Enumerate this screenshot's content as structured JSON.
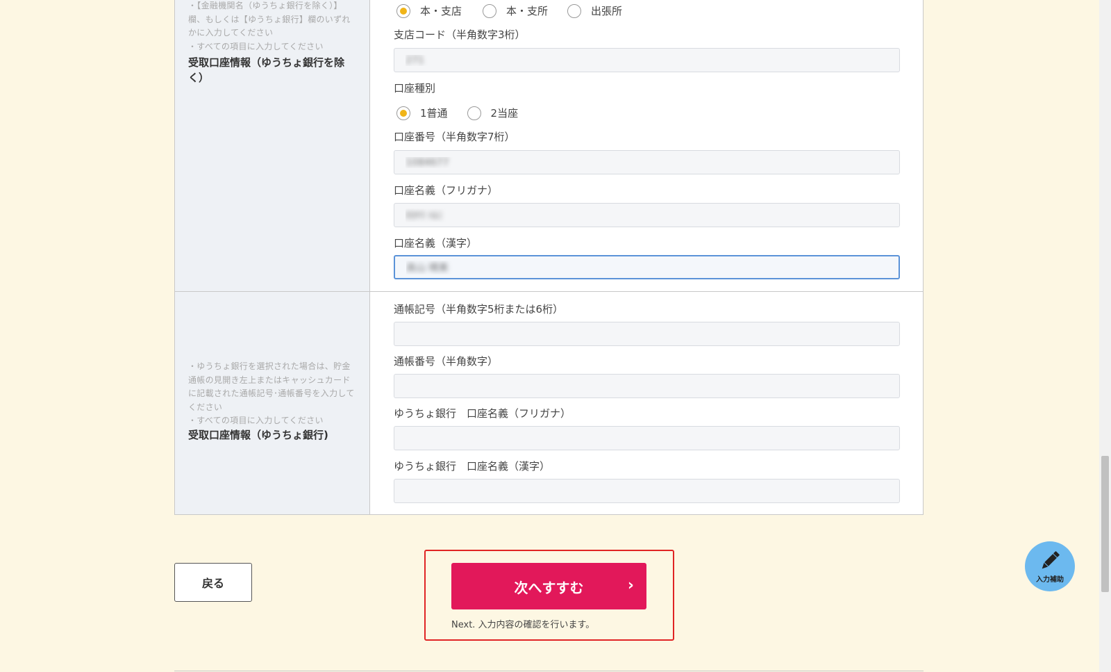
{
  "bank_section": {
    "notes": [
      "・【金融機関名（ゆうちょ銀行を除く）】欄、もしくは【ゆうちょ銀行】欄のいずれかに入力してください",
      "・すべての項目に入力してください"
    ],
    "title": "受取口座情報（ゆうちょ銀行を除く）",
    "branch_type_options": [
      {
        "label": "本・支店",
        "checked": true
      },
      {
        "label": "本・支所",
        "checked": false
      },
      {
        "label": "出張所",
        "checked": false
      }
    ],
    "branch_code": {
      "label": "支店コード（半角数字3桁）",
      "value": "271"
    },
    "account_type": {
      "label": "口座種別",
      "options": [
        {
          "label": "1普通",
          "checked": true
        },
        {
          "label": "2当座",
          "checked": false
        }
      ]
    },
    "account_number": {
      "label": "口座番号（半角数字7桁）",
      "value": "1084677"
    },
    "holder_kana": {
      "label": "口座名義（フリガナ）",
      "value": "ﾀｶﾔﾏ ﾊﾙﾐ"
    },
    "holder_kanji": {
      "label": "口座名義（漢字）",
      "value": "高山 晴美"
    }
  },
  "yucho_section": {
    "notes": [
      "・ゆうちょ銀行を選択された場合は、貯金通帳の見開き左上またはキャッシュカードに記載された通帳記号･通帳番号を入力してください",
      "・すべての項目に入力してください"
    ],
    "title": "受取口座情報（ゆうちょ銀行)",
    "passbook_symbol": {
      "label": "通帳記号（半角数字5桁または6桁）",
      "value": ""
    },
    "passbook_number": {
      "label": "通帳番号（半角数字）",
      "value": ""
    },
    "holder_kana": {
      "label": "ゆうちょ銀行　口座名義（フリガナ）",
      "value": ""
    },
    "holder_kanji": {
      "label": "ゆうちょ銀行　口座名義（漢字）",
      "value": ""
    }
  },
  "actions": {
    "back_label": "戻る",
    "next_label": "次へすすむ",
    "next_arrow": "›",
    "next_note": "Next. 入力内容の確認を行います。"
  },
  "assist": {
    "label": "入力補助",
    "icon": "pencil-icon"
  },
  "colors": {
    "background": "#fdf7e3",
    "primary_button": "#e2185a",
    "radio_checked": "#f0b418",
    "highlight_border": "#e02424",
    "assist_button": "#6cb9ef",
    "focus_border": "#5b93d8"
  }
}
